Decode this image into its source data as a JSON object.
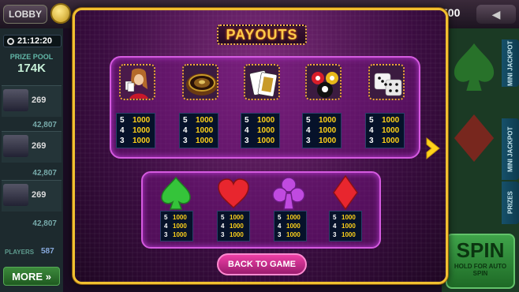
{
  "background": {
    "lobby_label": "LOBBY",
    "balance": "500",
    "timer": "21:12:20",
    "prize_pool_label": "PRIZE POOL",
    "prize_pool_value": "174K",
    "players": [
      {
        "score": "269",
        "total": "42,807"
      },
      {
        "score": "269",
        "total": "42,807"
      },
      {
        "score": "269",
        "total": "42,807"
      }
    ],
    "players_label": "PLAYERS",
    "players_count": "587",
    "more_label": "MORE »",
    "tabs": [
      "MINI JACKPOT",
      "MINI JACKPOT",
      "PRIZES"
    ],
    "spin_label": "SPIN",
    "spin_sub": "HOLD FOR AUTO SPIN"
  },
  "modal": {
    "title": "PAYOUTS",
    "back_label": "BACK TO GAME",
    "premium_symbols": [
      {
        "icon": "woman-cards-icon",
        "payouts": [
          {
            "count": "5",
            "amount": "1000"
          },
          {
            "count": "4",
            "amount": "1000"
          },
          {
            "count": "3",
            "amount": "1000"
          }
        ]
      },
      {
        "icon": "roulette-wheel-icon",
        "payouts": [
          {
            "count": "5",
            "amount": "1000"
          },
          {
            "count": "4",
            "amount": "1000"
          },
          {
            "count": "3",
            "amount": "1000"
          }
        ]
      },
      {
        "icon": "playing-cards-icon",
        "payouts": [
          {
            "count": "5",
            "amount": "1000"
          },
          {
            "count": "4",
            "amount": "1000"
          },
          {
            "count": "3",
            "amount": "1000"
          }
        ]
      },
      {
        "icon": "billiard-balls-icon",
        "payouts": [
          {
            "count": "5",
            "amount": "1000"
          },
          {
            "count": "4",
            "amount": "1000"
          },
          {
            "count": "3",
            "amount": "1000"
          }
        ]
      },
      {
        "icon": "dice-icon",
        "payouts": [
          {
            "count": "5",
            "amount": "1000"
          },
          {
            "count": "4",
            "amount": "1000"
          },
          {
            "count": "3",
            "amount": "1000"
          }
        ]
      }
    ],
    "suit_symbols": [
      {
        "icon": "spade-icon",
        "color": "#35c43a",
        "payouts": [
          {
            "count": "5",
            "amount": "1000"
          },
          {
            "count": "4",
            "amount": "1000"
          },
          {
            "count": "3",
            "amount": "1000"
          }
        ]
      },
      {
        "icon": "heart-icon",
        "color": "#e8262e",
        "payouts": [
          {
            "count": "5",
            "amount": "1000"
          },
          {
            "count": "4",
            "amount": "1000"
          },
          {
            "count": "3",
            "amount": "1000"
          }
        ]
      },
      {
        "icon": "club-icon",
        "color": "#c04ae0",
        "payouts": [
          {
            "count": "5",
            "amount": "1000"
          },
          {
            "count": "4",
            "amount": "1000"
          },
          {
            "count": "3",
            "amount": "1000"
          }
        ]
      },
      {
        "icon": "diamond-icon",
        "color": "#e8262e",
        "payouts": [
          {
            "count": "5",
            "amount": "1000"
          },
          {
            "count": "4",
            "amount": "1000"
          },
          {
            "count": "3",
            "amount": "1000"
          }
        ]
      }
    ]
  }
}
